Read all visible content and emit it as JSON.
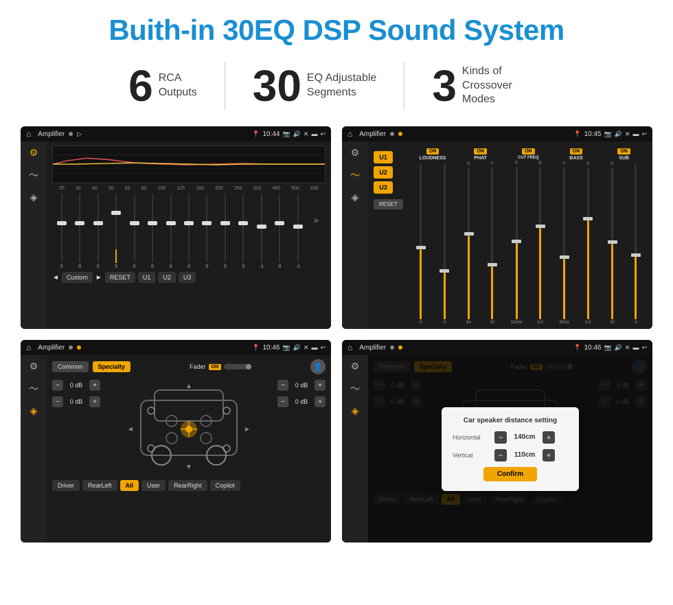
{
  "title": "Buith-in 30EQ DSP Sound System",
  "stats": [
    {
      "number": "6",
      "text": "RCA\nOutputs"
    },
    {
      "number": "30",
      "text": "EQ Adjustable\nSegments"
    },
    {
      "number": "3",
      "text": "Kinds of\nCrossover Modes"
    }
  ],
  "screens": [
    {
      "id": "eq-screen",
      "app_name": "Amplifier",
      "time": "10:44",
      "type": "eq",
      "freqs": [
        "25",
        "32",
        "40",
        "50",
        "63",
        "80",
        "100",
        "125",
        "160",
        "200",
        "250",
        "320",
        "400",
        "500",
        "630"
      ],
      "values": [
        "0",
        "0",
        "0",
        "5",
        "0",
        "0",
        "0",
        "0",
        "0",
        "0",
        "0",
        "-1",
        "0",
        "-1"
      ],
      "preset_label": "Custom",
      "buttons": [
        "RESET",
        "U1",
        "U2",
        "U3"
      ]
    },
    {
      "id": "crossover-screen",
      "app_name": "Amplifier",
      "time": "10:45",
      "type": "crossover",
      "presets": [
        "U1",
        "U2",
        "U3"
      ],
      "columns": [
        {
          "label": "LOUDNESS",
          "on": true
        },
        {
          "label": "PHAT",
          "on": true
        },
        {
          "label": "CUT FREQ",
          "on": true
        },
        {
          "label": "BASS",
          "on": true
        },
        {
          "label": "SUB",
          "on": true
        }
      ]
    },
    {
      "id": "fader-screen",
      "app_name": "Amplifier",
      "time": "10:46",
      "type": "fader",
      "tabs": [
        "Common",
        "Specialty"
      ],
      "active_tab": "Specialty",
      "fader_label": "Fader",
      "fader_on": true,
      "volumes": [
        "0 dB",
        "0 dB",
        "0 dB",
        "0 dB"
      ],
      "zones": [
        "Driver",
        "RearLeft",
        "All",
        "User",
        "RearRight",
        "Copilot"
      ]
    },
    {
      "id": "fader-dialog-screen",
      "app_name": "Amplifier",
      "time": "10:46",
      "type": "fader-dialog",
      "tabs": [
        "Common",
        "Specialty"
      ],
      "active_tab": "Specialty",
      "dialog": {
        "title": "Car speaker distance setting",
        "rows": [
          {
            "label": "Horizontal",
            "value": "140cm"
          },
          {
            "label": "Vertical",
            "value": "110cm"
          }
        ],
        "confirm_label": "Confirm"
      },
      "zones": [
        "Driver",
        "RearLeft",
        "All",
        "User",
        "RearRight",
        "Copilot"
      ]
    }
  ]
}
